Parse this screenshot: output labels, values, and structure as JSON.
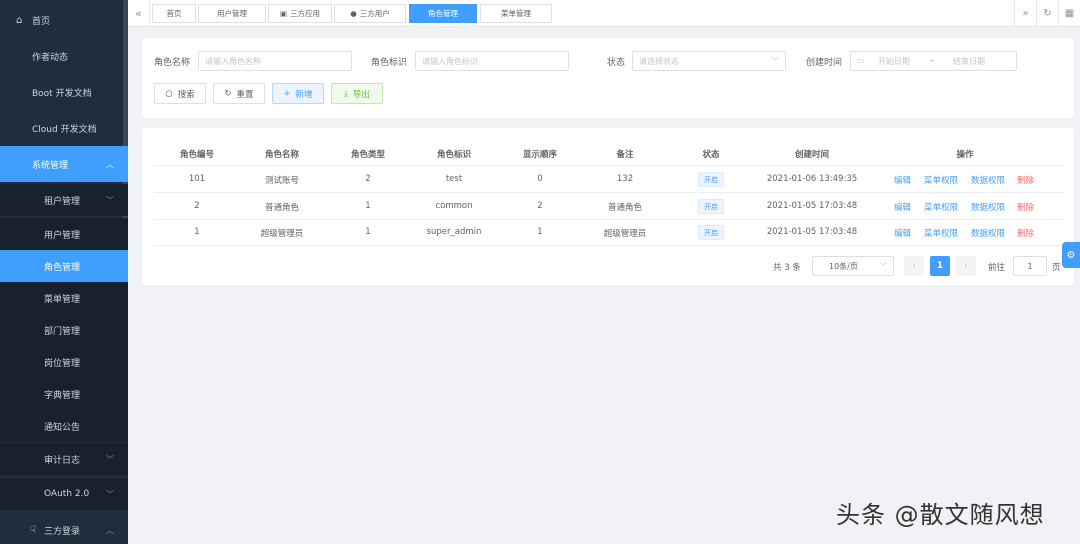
{
  "sidebar": {
    "items": [
      {
        "label": "首页",
        "icon": "home-icon"
      },
      {
        "label": "作者动态"
      },
      {
        "label": "Boot 开发文档"
      },
      {
        "label": "Cloud 开发文档"
      },
      {
        "label": "系统管理"
      },
      {
        "label": "租户管理"
      },
      {
        "label": "用户管理"
      },
      {
        "label": "角色管理"
      },
      {
        "label": "菜单管理"
      },
      {
        "label": "部门管理"
      },
      {
        "label": "岗位管理"
      },
      {
        "label": "字典管理"
      },
      {
        "label": "通知公告"
      },
      {
        "label": "审计日志"
      },
      {
        "label": "OAuth 2.0"
      },
      {
        "label": "三方登录",
        "icon": "hand-icon"
      }
    ]
  },
  "tabs": [
    {
      "label": "首页"
    },
    {
      "label": "用户管理"
    },
    {
      "label": "三方应用"
    },
    {
      "label": "三方用户"
    },
    {
      "label": "角色管理"
    },
    {
      "label": "菜单管理"
    }
  ],
  "search": {
    "role_name_label": "角色名称",
    "role_name_placeholder": "请输入角色名称",
    "role_key_label": "角色标识",
    "role_key_placeholder": "请输入角色标识",
    "status_label": "状态",
    "status_placeholder": "请选择状态",
    "created_label": "创建时间",
    "start_placeholder": "开始日期",
    "range_sep": "-",
    "end_placeholder": "结束日期",
    "search_btn": "搜索",
    "reset_btn": "重置",
    "add_btn": "新增",
    "export_btn": "导出"
  },
  "table": {
    "headers": [
      "角色编号",
      "角色名称",
      "角色类型",
      "角色标识",
      "显示顺序",
      "备注",
      "状态",
      "创建时间",
      "操作"
    ],
    "rows": [
      {
        "id": "101",
        "name": "测试账号",
        "type": "2",
        "key": "test",
        "sort": "0",
        "remark": "132",
        "status": "开启",
        "created": "2021-01-06 13:49:35"
      },
      {
        "id": "2",
        "name": "普通角色",
        "type": "1",
        "key": "common",
        "sort": "2",
        "remark": "普通角色",
        "status": "开启",
        "created": "2021-01-05 17:03:48"
      },
      {
        "id": "1",
        "name": "超级管理员",
        "type": "1",
        "key": "super_admin",
        "sort": "1",
        "remark": "超级管理员",
        "status": "开启",
        "created": "2021-01-05 17:03:48"
      }
    ],
    "ops": {
      "edit": "编辑",
      "menu_perm": "菜单权限",
      "data_perm": "数据权限",
      "delete": "删除"
    }
  },
  "pagination": {
    "total": "共 3 条",
    "page_size": "10条/页",
    "current": "1",
    "goto_label": "前往",
    "goto_value": "1",
    "page_unit": "页"
  },
  "watermark": "头条 @散文随风想",
  "colors": {
    "primary": "#409eff",
    "sidebar": "#1f2d3d",
    "danger": "#f56c6c",
    "success": "#67c23a"
  }
}
